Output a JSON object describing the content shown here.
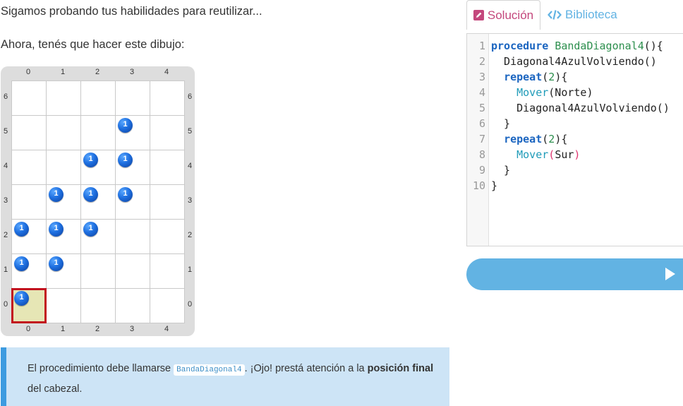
{
  "intro": "Sigamos probando tus habilidades para reutilizar...",
  "task": "Ahora, tenés que hacer este dibujo:",
  "board": {
    "cols": [
      "0",
      "1",
      "2",
      "3",
      "4"
    ],
    "rows": [
      "0",
      "1",
      "2",
      "3",
      "4",
      "5",
      "6"
    ],
    "head": {
      "x": 0,
      "y": 0
    },
    "ball_label": "1",
    "balls": [
      {
        "x": 0,
        "y": 0
      },
      {
        "x": 0,
        "y": 1
      },
      {
        "x": 1,
        "y": 1
      },
      {
        "x": 0,
        "y": 2
      },
      {
        "x": 1,
        "y": 2
      },
      {
        "x": 2,
        "y": 2
      },
      {
        "x": 1,
        "y": 3
      },
      {
        "x": 2,
        "y": 3
      },
      {
        "x": 3,
        "y": 3
      },
      {
        "x": 2,
        "y": 4
      },
      {
        "x": 3,
        "y": 4
      },
      {
        "x": 3,
        "y": 5
      }
    ],
    "ball_color": "#1e6fe0"
  },
  "info": {
    "text_before": "El procedimiento debe llamarse ",
    "code": "BandaDiagonal4",
    "text_middle": ". ¡Ojo! prestá atención a la ",
    "bold": "posición final",
    "text_after": " del cabezal."
  },
  "tabs": {
    "solution": "Solución",
    "library": "Biblioteca",
    "solution_icon": "pencil-square-icon",
    "library_icon": "code-icon"
  },
  "editor": {
    "line_numbers": [
      "1",
      "2",
      "3",
      "4",
      "5",
      "6",
      "7",
      "8",
      "9",
      "10"
    ]
  },
  "run_button": {
    "icon": "play-icon",
    "color": "#62b3e3"
  }
}
